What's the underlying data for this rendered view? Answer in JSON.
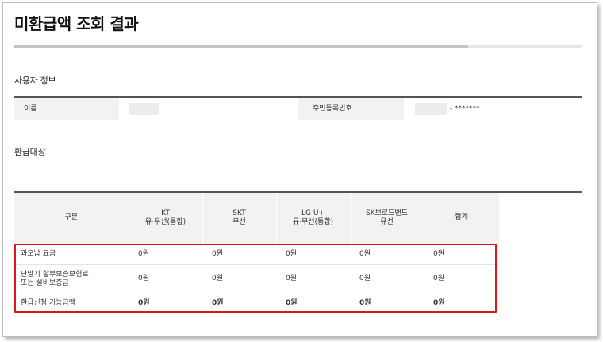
{
  "page": {
    "title": "미환급액 조회 결과"
  },
  "user_info": {
    "heading": "사용자 정보",
    "name_label": "이름",
    "rrn_label": "주민등록번호",
    "rrn_masked_suffix": "- *******"
  },
  "refund": {
    "heading": "환급대상",
    "columns": [
      {
        "line1": "구분",
        "line2": ""
      },
      {
        "line1": "KT",
        "line2": "유·무선(통합)"
      },
      {
        "line1": "SKT",
        "line2": "무선"
      },
      {
        "line1": "LG U+",
        "line2": "유·무선(통합)"
      },
      {
        "line1": "SK브로드밴드",
        "line2": "유선"
      },
      {
        "line1": "합계",
        "line2": ""
      }
    ],
    "rows": [
      {
        "label_line1": "과오납 요금",
        "label_line2": "",
        "kt": "0원",
        "skt": "0원",
        "lgu": "0원",
        "skb": "0원",
        "total": "0원"
      },
      {
        "label_line1": "단말기 할부보증보험료",
        "label_line2": "또는 설비보증금",
        "kt": "0원",
        "skt": "0원",
        "lgu": "0원",
        "skb": "0원",
        "total": "0원"
      },
      {
        "label_line1": "환급신청 가능금액",
        "label_line2": "",
        "kt": "0원",
        "skt": "0원",
        "lgu": "0원",
        "skb": "0원",
        "total": "0원"
      }
    ]
  },
  "colors": {
    "highlight_border": "#e0141e",
    "header_bg": "#f2f2f2",
    "rule": "#555555"
  }
}
